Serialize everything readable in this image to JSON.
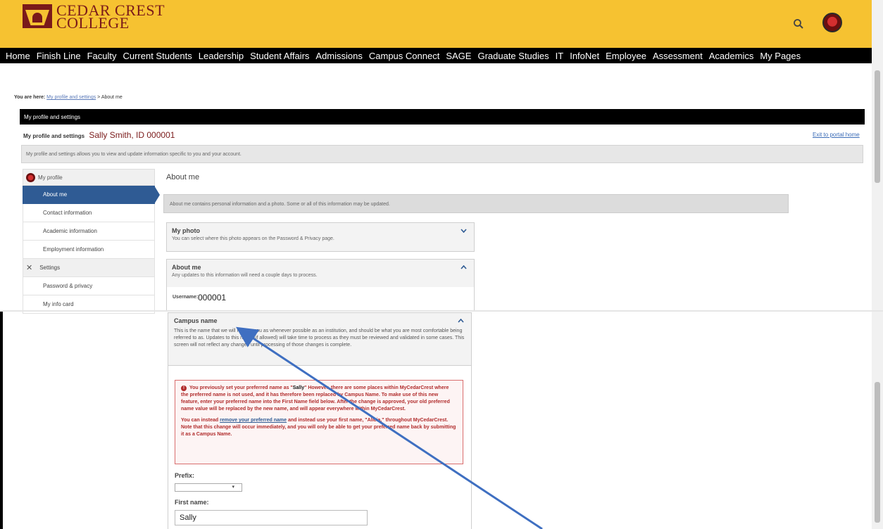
{
  "header": {
    "logo_line1": "CEDAR CREST",
    "logo_line2": "COLLEGE"
  },
  "nav": [
    "Home",
    "Finish Line",
    "Faculty",
    "Current Students",
    "Leadership",
    "Student Affairs",
    "Admissions",
    "Campus Connect",
    "SAGE",
    "Graduate Studies",
    "IT",
    "InfoNet",
    "Employee",
    "Assessment",
    "Academics",
    "My Pages"
  ],
  "breadcrumb": {
    "prefix": "You are here:",
    "link": "My profile and settings",
    "sep": " > ",
    "current": "About me"
  },
  "panel": {
    "bar_title": "My profile and settings",
    "title": "My profile and settings",
    "who": "Sally Smith, ID 000001",
    "exit": "Exit to portal home",
    "info": "My profile and settings allows you to view and update information specific to you and your account."
  },
  "sidebar": {
    "head": "My profile",
    "items": [
      "About me",
      "Contact information",
      "Academic information",
      "Employment information"
    ],
    "settings": "Settings",
    "settings_items": [
      "Password & privacy",
      "My info card"
    ]
  },
  "main": {
    "heading": "About me",
    "info": "About me contains personal information and a photo. Some or all of this information may be updated.",
    "photo_title": "My photo",
    "photo_sub": "You can select where this photo appears on the Password & Privacy page.",
    "about_title": "About me",
    "about_sub": "Any updates to this information will need a couple days to process.",
    "username_label": "Username:",
    "username_value": "000001"
  },
  "campus": {
    "title": "Campus name",
    "desc": "This is the name that we will refer to you as whenever possible as an institution, and should be what you are most comfortable being referred to as. Updates to this name (if allowed) will take time to process as they must be reviewed and validated in some cases. This screen will not reflect any changes until processing of those changes is complete.",
    "alert_p1_a": "You previously set your preferred name as \"",
    "alert_name": "Sally",
    "alert_p1_b": "\" However, there are some places within MyCedarCrest where the preferred name is not used, and it has therefore been replaced by Campus Name. To make use of this new feature, enter your preferred name into the First Name field below. After the change is approved, your old preferred name value will be replaced by the new name, and will appear everywhere within MyCedarCrest.",
    "alert_p2_a": "You can instead ",
    "alert_link": "remove your preferred name",
    "alert_p2_b": " and instead use your first name, \"Alicia,\" throughout MyCedarCrest. Note that this change will occur immediately, and you will only be able to get your preferred name back by submitting it as a Campus Name.",
    "prefix_label": "Prefix:",
    "first_label": "First name:",
    "first_value": "Sally"
  },
  "colors": {
    "header": "#f6c231",
    "accent": "#2f5b94",
    "brand": "#7a1a1a",
    "arrow": "#3f6fc1"
  }
}
